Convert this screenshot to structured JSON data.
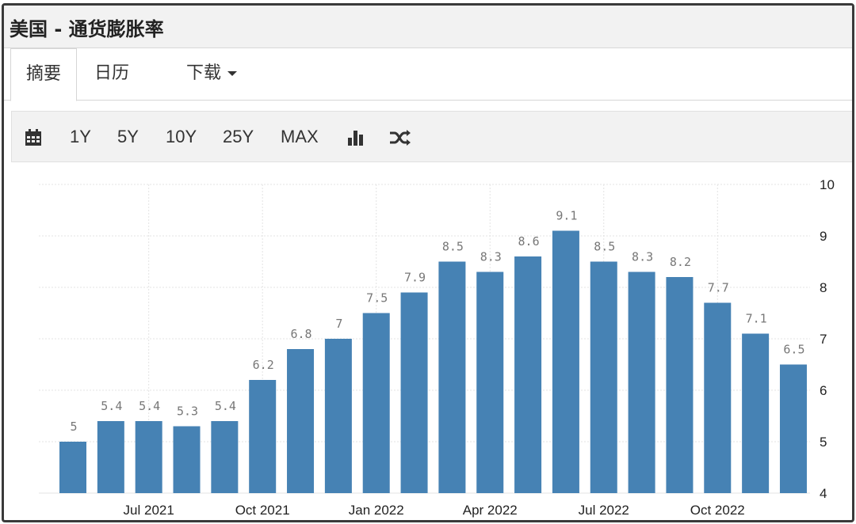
{
  "header": {
    "title": "美国 - 通货膨胀率"
  },
  "tabs": [
    {
      "label": "摘要",
      "active": true
    },
    {
      "label": "日历",
      "active": false
    },
    {
      "label": "下载",
      "active": false,
      "dropdown": true
    }
  ],
  "toolbar": {
    "calendar_icon": "calendar-icon",
    "ranges": [
      "1Y",
      "5Y",
      "10Y",
      "25Y",
      "MAX"
    ],
    "chart_type_icon": "bar-chart-icon",
    "compare_icon": "shuffle-icon"
  },
  "colors": {
    "bar": "#4682b4",
    "grid": "#e3e3e3",
    "value_label": "#777777"
  },
  "chart_data": {
    "type": "bar",
    "categories": [
      "May 2021",
      "Jun 2021",
      "Jul 2021",
      "Aug 2021",
      "Sep 2021",
      "Oct 2021",
      "Nov 2021",
      "Dec 2021",
      "Jan 2022",
      "Feb 2022",
      "Mar 2022",
      "Apr 2022",
      "May 2022",
      "Jun 2022",
      "Jul 2022",
      "Aug 2022",
      "Sep 2022",
      "Oct 2022",
      "Nov 2022",
      "Dec 2022"
    ],
    "values": [
      5,
      5.4,
      5.4,
      5.3,
      5.4,
      6.2,
      6.8,
      7,
      7.5,
      7.9,
      8.5,
      8.3,
      8.6,
      9.1,
      8.5,
      8.3,
      8.2,
      7.7,
      7.1,
      6.5
    ],
    "x_tick_labels": [
      {
        "label": "Jul 2021",
        "category": "Jul 2021"
      },
      {
        "label": "Oct 2021",
        "category": "Oct 2021"
      },
      {
        "label": "Jan 2022",
        "category": "Jan 2022"
      },
      {
        "label": "Apr 2022",
        "category": "Apr 2022"
      },
      {
        "label": "Jul 2022",
        "category": "Jul 2022"
      },
      {
        "label": "Oct 2022",
        "category": "Oct 2022"
      }
    ],
    "y_ticks": [
      4,
      5,
      6,
      7,
      8,
      9,
      10
    ],
    "ylim": [
      4,
      10
    ],
    "y_axis_side": "right",
    "grid": true,
    "data_labels": true,
    "title": "",
    "xlabel": "",
    "ylabel": ""
  }
}
